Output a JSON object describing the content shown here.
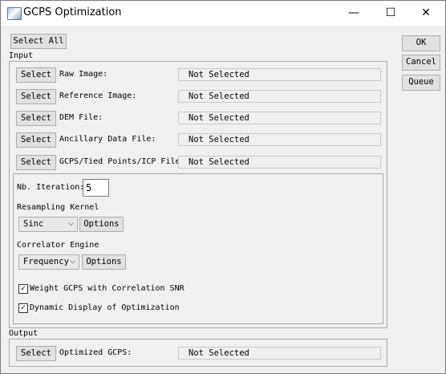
{
  "window": {
    "title": "GCPS Optimization",
    "minimize": "—",
    "maximize": "☐",
    "close": "✕"
  },
  "toolbar": {
    "select_all": "Select All"
  },
  "side_buttons": {
    "ok": "OK",
    "cancel": "Cancel",
    "queue": "Queue"
  },
  "input": {
    "section_label": "Input",
    "rows": [
      {
        "button": "Select",
        "label": "Raw Image:",
        "value": "Not Selected"
      },
      {
        "button": "Select",
        "label": "Reference Image:",
        "value": "Not Selected"
      },
      {
        "button": "Select",
        "label": "DEM File:",
        "value": "Not Selected"
      },
      {
        "button": "Select",
        "label": "Ancillary Data File:",
        "value": "Not Selected"
      },
      {
        "button": "Select",
        "label": "GCPS/Tied Points/ICP File:",
        "value": "Not Selected"
      }
    ]
  },
  "options": {
    "iteration_label": "Nb. Iteration:",
    "iteration_value": "5",
    "resampling_label": "Resampling Kernel",
    "resampling_value": "Sinc",
    "resampling_options": "Options",
    "correlator_label": "Correlator Engine",
    "correlator_value": "Frequency",
    "correlator_options": "Options",
    "weight_label": "Weight GCPS with Correlation SNR",
    "weight_checked": true,
    "dynamic_label": "Dynamic Display of Optimization",
    "dynamic_checked": true,
    "check_mark": "✓"
  },
  "output": {
    "section_label": "Output",
    "button": "Select",
    "label": "Optimized GCPS:",
    "value": "Not Selected"
  },
  "icons": {
    "chevron": "⌵"
  }
}
